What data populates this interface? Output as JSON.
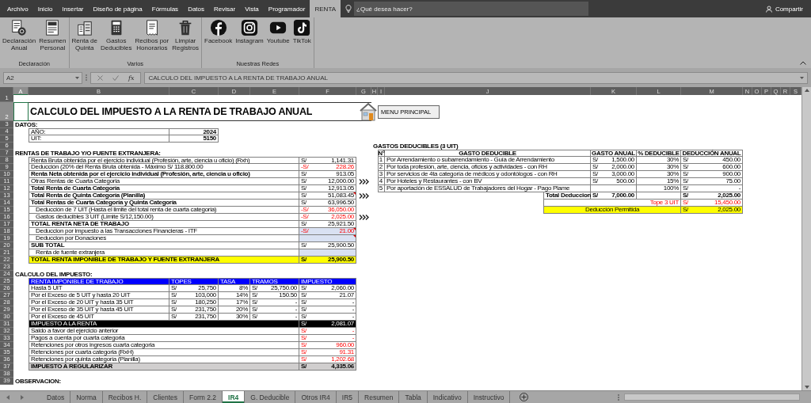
{
  "menu_tabs": [
    {
      "label": "Archivo",
      "selected": false
    },
    {
      "label": "Inicio",
      "selected": false
    },
    {
      "label": "Insertar",
      "selected": false
    },
    {
      "label": "Diseño de página",
      "selected": false
    },
    {
      "label": "Fórmulas",
      "selected": false
    },
    {
      "label": "Datos",
      "selected": false
    },
    {
      "label": "Revisar",
      "selected": false
    },
    {
      "label": "Vista",
      "selected": false
    },
    {
      "label": "Programador",
      "selected": false
    },
    {
      "label": "RENTA",
      "selected": true
    }
  ],
  "search": {
    "placeholder": "¿Qué desea hacer?"
  },
  "share_button": "Compartir",
  "ribbon_groups": [
    {
      "label": "Declaración",
      "buttons": [
        "Declaración\nAnual",
        "Resumen\nPersonal"
      ]
    },
    {
      "label": "Varios",
      "buttons": [
        "Renta de\nQuinta",
        "Gastos\nDeducibles",
        "Recibos por\nHonorarios",
        "Limpiar\nRegistros"
      ]
    },
    {
      "label": "Nuestras Redes",
      "buttons": [
        "Facebook",
        "Instagram",
        "Youtube",
        "TikTok"
      ]
    }
  ],
  "name_box": "A2",
  "function_label": "fx",
  "formula": "CALCULO DEL IMPUESTO A LA RENTA DE TRABAJO ANUAL",
  "column_headers": [
    {
      "label": "A",
      "selected": true
    },
    {
      "label": "B",
      "selected": false
    },
    {
      "label": "C",
      "selected": false
    },
    {
      "label": "D",
      "selected": false
    },
    {
      "label": "E",
      "selected": false
    },
    {
      "label": "F",
      "selected": false
    },
    {
      "label": "G",
      "selected": false
    },
    {
      "label": "H",
      "selected": false
    },
    {
      "label": "I",
      "selected": false
    },
    {
      "label": "J",
      "selected": false
    },
    {
      "label": "K",
      "selected": false
    },
    {
      "label": "L",
      "selected": false
    },
    {
      "label": "M",
      "selected": false
    },
    {
      "label": "N",
      "selected": false
    },
    {
      "label": "O",
      "selected": false
    },
    {
      "label": "P",
      "selected": false
    },
    {
      "label": "Q",
      "selected": false
    },
    {
      "label": "R",
      "selected": false
    },
    {
      "label": "S",
      "selected": false
    }
  ],
  "row_numbers": [
    {
      "label": "1",
      "selected": false
    },
    {
      "label": "2",
      "selected": true
    },
    {
      "label": "3",
      "selected": false
    },
    {
      "label": "4",
      "selected": false
    },
    {
      "label": "5",
      "selected": false
    },
    {
      "label": "6",
      "selected": false
    },
    {
      "label": "7",
      "selected": false
    },
    {
      "label": "8",
      "selected": false
    },
    {
      "label": "9",
      "selected": false
    },
    {
      "label": "10",
      "selected": false
    },
    {
      "label": "11",
      "selected": false
    },
    {
      "label": "12",
      "selected": false
    },
    {
      "label": "13",
      "selected": false
    },
    {
      "label": "14",
      "selected": false
    },
    {
      "label": "15",
      "selected": false
    },
    {
      "label": "16",
      "selected": false
    },
    {
      "label": "17",
      "selected": false
    },
    {
      "label": "18",
      "selected": false
    },
    {
      "label": "19",
      "selected": false
    },
    {
      "label": "20",
      "selected": false
    },
    {
      "label": "21",
      "selected": false
    },
    {
      "label": "22",
      "selected": false
    },
    {
      "label": "23",
      "selected": false
    },
    {
      "label": "24",
      "selected": false
    },
    {
      "label": "25",
      "selected": false
    },
    {
      "label": "26",
      "selected": false
    },
    {
      "label": "27",
      "selected": false
    },
    {
      "label": "28",
      "selected": false
    },
    {
      "label": "29",
      "selected": false
    },
    {
      "label": "30",
      "selected": false
    },
    {
      "label": "31",
      "selected": false
    },
    {
      "label": "32",
      "selected": false
    },
    {
      "label": "33",
      "selected": false
    },
    {
      "label": "34",
      "selected": false
    },
    {
      "label": "35",
      "selected": false
    },
    {
      "label": "36",
      "selected": false
    },
    {
      "label": "37",
      "selected": false
    },
    {
      "label": "38",
      "selected": false
    },
    {
      "label": "39",
      "selected": false
    }
  ],
  "title": "CALCULO DEL IMPUESTO A LA RENTA DE TRABAJO ANUAL",
  "menu_button": "MENU PRINCIPAL",
  "datos": {
    "heading": "DATOS:",
    "rows": [
      {
        "label": "AÑO:",
        "value": "2024"
      },
      {
        "label": "UIT:",
        "value": "5150"
      }
    ]
  },
  "rentas": {
    "heading": "RENTAS DE TRABAJO Y/O FUENTE EXTRANJERA:",
    "rows": [
      {
        "label": "Renta Bruta obtenida por el ejercicio individual (Profesión, arte, ciencia u oficio) (Rxh)",
        "currency": "S/",
        "value": "1,141.31",
        "bold": false,
        "indent": false,
        "negative": false,
        "input": false,
        "note": false,
        "arrow": false,
        "highlight": false
      },
      {
        "label": "Deducción (20% del Renta Bruta obtenida - Máximo S/ 118.800.00",
        "currency": "-S/",
        "value": "228.26",
        "bold": false,
        "indent": false,
        "negative": true,
        "input": false,
        "note": false,
        "arrow": false,
        "highlight": false
      },
      {
        "label": "Renta Neta obtenida por el ejercicio individual (Profesión, arte, ciencia u oficio)",
        "currency": "S/",
        "value": "913.05",
        "bold": true,
        "indent": false,
        "negative": false,
        "input": false,
        "note": false,
        "arrow": false,
        "highlight": false
      },
      {
        "label": "Otras Rentas de Cuarta Categoria",
        "currency": "S/",
        "value": "12,000.00",
        "bold": false,
        "indent": false,
        "negative": false,
        "input": false,
        "note": false,
        "arrow": true,
        "highlight": false
      },
      {
        "label": "Total Renta de Cuarta Categoría",
        "currency": "S/",
        "value": "12,913.05",
        "bold": true,
        "indent": false,
        "negative": false,
        "input": false,
        "note": false,
        "arrow": false,
        "highlight": false
      },
      {
        "label": "Total Renta de Quinta Categoría (Planilla)",
        "currency": "S/",
        "value": "51,083.45",
        "bold": true,
        "indent": false,
        "negative": false,
        "input": false,
        "note": true,
        "arrow": true,
        "highlight": false
      },
      {
        "label": "Total Rentas de Cuarta Categoría y Quinta Categoría",
        "currency": "S/",
        "value": "63,996.50",
        "bold": true,
        "indent": false,
        "negative": false,
        "input": false,
        "note": false,
        "arrow": false,
        "highlight": false
      },
      {
        "label": "Deducción de 7 UIT (Hasta el limite del total renta de cuarta categoria)",
        "currency": "-S/",
        "value": "36,050.00",
        "bold": false,
        "indent": true,
        "negative": true,
        "input": false,
        "note": false,
        "arrow": false,
        "highlight": false
      },
      {
        "label": "Gastos deducibles 3 UIT (Limite S/12,150.00)",
        "currency": "-S/",
        "value": "2,025.00",
        "bold": false,
        "indent": true,
        "negative": true,
        "input": false,
        "note": false,
        "arrow": true,
        "highlight": false
      },
      {
        "label": "TOTAL RENTA NETA DE TRABAJO",
        "currency": "S/",
        "value": "25,921.50",
        "bold": true,
        "indent": false,
        "negative": false,
        "input": false,
        "note": false,
        "arrow": false,
        "highlight": false
      },
      {
        "label": "Deduccion por impuesto a las Transacciones Financieras - ITF",
        "currency": "-S/",
        "value": "21.00",
        "bold": false,
        "indent": true,
        "negative": true,
        "input": true,
        "note": true,
        "arrow": false,
        "highlight": false
      },
      {
        "label": "Deduccion por Donaciones",
        "bold": false,
        "indent": true,
        "negative": false,
        "input": true,
        "note": true,
        "arrow": false,
        "highlight": false
      },
      {
        "label": "SUB TOTAL",
        "currency": "S/",
        "value": "25,900.50",
        "bold": true,
        "indent": false,
        "negative": false,
        "input": false,
        "note": false,
        "arrow": false,
        "highlight": false
      },
      {
        "label": "Renta de fuente extranjera",
        "bold": false,
        "indent": true,
        "negative": false,
        "input": true,
        "note": false,
        "arrow": false,
        "highlight": false
      },
      {
        "label": "TOTAL RENTA IMPONIBLE DE TRABAJO Y FUENTE EXTRANJERA",
        "currency": "S/",
        "value": "25,900.50",
        "bold": true,
        "indent": false,
        "negative": false,
        "input": false,
        "note": false,
        "arrow": false,
        "highlight": true
      }
    ]
  },
  "gastos": {
    "title": "GASTOS DEDUCIBLES (3 UIT)",
    "columns": [
      "N°",
      "GASTO DEDUCIBLE",
      "GASTO ANUAL",
      "% DEDUCIBLE",
      "DEDUCCIÓN ANUAL"
    ],
    "items": [
      {
        "number": "1",
        "label": "Por Arrendamiento o subarrendamiento - Guía de Arrendamiento",
        "currency": "S/",
        "amount": "1,500.00",
        "percent": "30%",
        "deduction_currency": "S/",
        "deduction": "450.00"
      },
      {
        "number": "2",
        "label": "Por toda profesión, arte, ciencia, oficios y actividades - con RH",
        "currency": "S/",
        "amount": "2,000.00",
        "percent": "30%",
        "deduction_currency": "S/",
        "deduction": "600.00"
      },
      {
        "number": "3",
        "label": "Por servicios de 4ta categoría de médicos y odontólogos - con RH",
        "currency": "S/",
        "amount": "3,000.00",
        "percent": "30%",
        "deduction_currency": "S/",
        "deduction": "900.00"
      },
      {
        "number": "4",
        "label": "Por Hoteles y Restaurantes - con BV",
        "currency": "S/",
        "amount": "500.00",
        "percent": "15%",
        "deduction_currency": "S/",
        "deduction": "75.00"
      },
      {
        "number": "5",
        "label": "Por aportación de ESSALUD de Trabajadores del Hogar - Pago Plame",
        "percent": "100%",
        "deduction_currency": "S/",
        "deduction": "-"
      }
    ],
    "total": {
      "label": "Total Deduccion",
      "currency": "S/",
      "amount": "7,000.00",
      "deduction_currency": "S/",
      "deduction": "2,025.00"
    },
    "tope": {
      "label": "Tope 3 UIT",
      "currency": "S/",
      "value": "15,450.00"
    },
    "permitted": {
      "label": "Deducción Permitida",
      "currency": "S/",
      "value": "2,025.00"
    }
  },
  "calculo": {
    "heading": "CALCULO DEL IMPUESTO:",
    "columns": [
      "RENTA IMPONIBLE DE TRABAJO",
      "TOPES",
      "TASA",
      "TRAMOS",
      "IMPUESTO"
    ],
    "brackets": [
      {
        "label": "Hasta 5 UIT",
        "cells": [
          {
            "currency": "S/",
            "value": "25,750"
          },
          {
            "value": "8%"
          },
          {
            "currency": "S/",
            "value": "25,750.00"
          },
          {
            "currency": "S/",
            "value": "2,060.00"
          }
        ]
      },
      {
        "label": "Por el Exceso de 5 UIT y hasta 20 UIT",
        "cells": [
          {
            "currency": "S/",
            "value": "103,000"
          },
          {
            "value": "14%"
          },
          {
            "currency": "S/",
            "value": "150.50"
          },
          {
            "currency": "S/",
            "value": "21.07"
          }
        ]
      },
      {
        "label": "Por el Exceso de 20 UIT y hasta 35 UIT",
        "cells": [
          {
            "currency": "S/",
            "value": "180,250"
          },
          {
            "value": "17%"
          },
          {
            "currency": "S/",
            "value": "-"
          },
          {
            "currency": "S/",
            "value": "-"
          }
        ]
      },
      {
        "label": "Por el Exceso de 35 UIT y hasta 45 UIT",
        "cells": [
          {
            "currency": "S/",
            "value": "231,750"
          },
          {
            "value": "20%"
          },
          {
            "currency": "S/",
            "value": "-"
          },
          {
            "currency": "S/",
            "value": "-"
          }
        ]
      },
      {
        "label": "Por el Exceso de 45 UIT",
        "cells": [
          {
            "currency": "S/",
            "value": "231,750"
          },
          {
            "value": "30%"
          },
          {
            "currency": "S/",
            "value": "-"
          },
          {
            "currency": "S/",
            "value": "-"
          }
        ]
      }
    ],
    "summary": [
      {
        "label": "IMPUESTO A LA RENTA",
        "kind": "result",
        "currency": "S/",
        "value": "2,081.07"
      },
      {
        "label": "Saldo a favor del ejercicio anterior",
        "kind": "credit",
        "currency": "S/",
        "value": "-"
      },
      {
        "label": "Pagos a cuenta por cuarta categoria",
        "kind": "credit",
        "currency": "S/",
        "value": "-"
      },
      {
        "label": "Retenciones por otros ingresos cuarta categoria",
        "kind": "credit",
        "currency": "S/",
        "value": "960.00"
      },
      {
        "label": "Retenciones por cuarta categoria (RxH)",
        "kind": "credit",
        "currency": "S/",
        "value": "91.31"
      },
      {
        "label": "Retenciones por quinta categoria (Planilla)",
        "kind": "credit",
        "currency": "S/",
        "value": "1,202.68"
      },
      {
        "label": "IMPUESTO A REGULARIZAR",
        "kind": "final",
        "currency": "S/",
        "value": "4,335.06"
      }
    ]
  },
  "observacion": "OBSERVACION:",
  "sheet_tabs": [
    {
      "label": "Datos",
      "selected": false
    },
    {
      "label": "Norma",
      "selected": false
    },
    {
      "label": "Recibos H.",
      "selected": false
    },
    {
      "label": "Clientes",
      "selected": false
    },
    {
      "label": "Form 2.2",
      "selected": false
    },
    {
      "label": "IR4",
      "selected": true
    },
    {
      "label": "G. Deducible",
      "selected": false
    },
    {
      "label": "Otros IR4",
      "selected": false
    },
    {
      "label": "IR5",
      "selected": false
    },
    {
      "label": "Resumen",
      "selected": false
    },
    {
      "label": "Tabla",
      "selected": false
    },
    {
      "label": "Indicativo",
      "selected": false
    },
    {
      "label": "Instructivo",
      "selected": false
    }
  ]
}
